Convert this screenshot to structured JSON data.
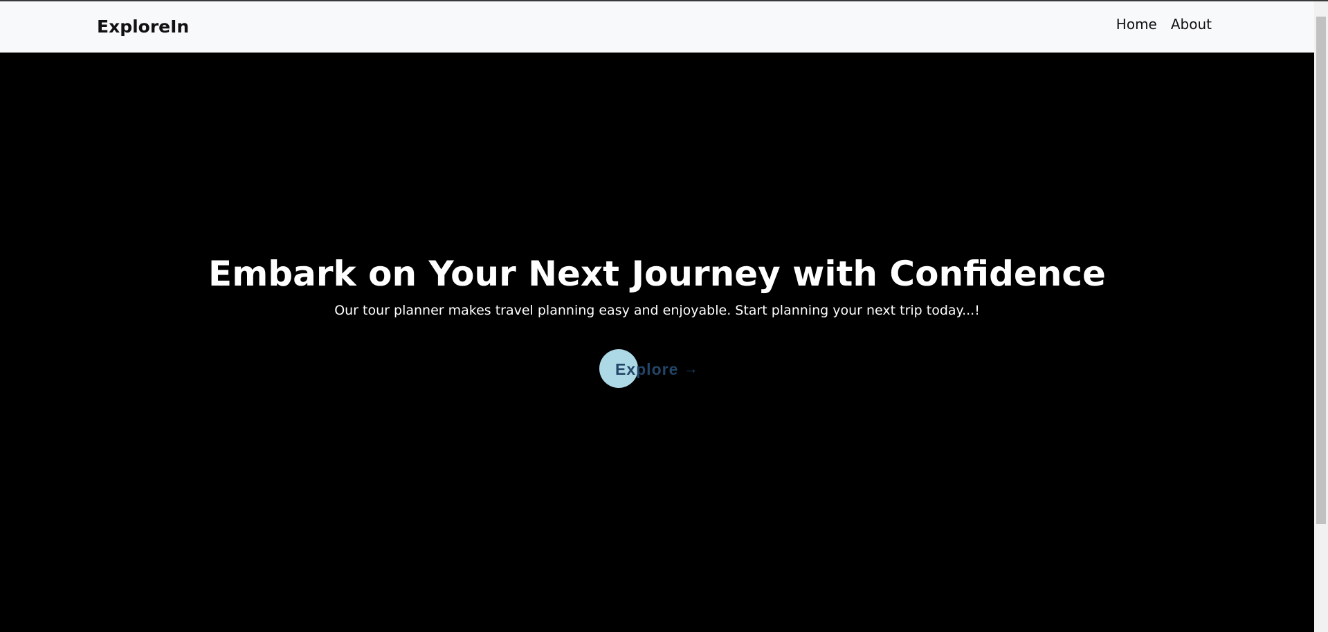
{
  "navbar": {
    "brand": "ExploreIn",
    "links": [
      "Home",
      "About"
    ]
  },
  "hero": {
    "title": "Embark on Your Next Journey with Confidence",
    "subtitle": "Our tour planner makes travel planning easy and enjoyable. Start planning your next trip today...!",
    "button_label": "Explore",
    "button_arrow": "→"
  },
  "colors": {
    "navbar_bg": "#f8f9fa",
    "hero_bg": "#000000",
    "button_circle": "#add8e6",
    "button_text": "#234567"
  },
  "scroll": {
    "visible_fraction": 0.82
  }
}
